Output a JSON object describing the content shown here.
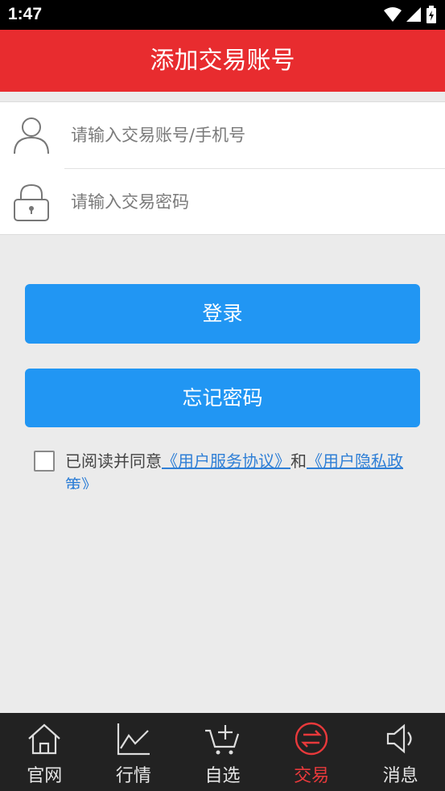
{
  "status_bar": {
    "time": "1:47"
  },
  "header": {
    "title": "添加交易账号"
  },
  "form": {
    "account_placeholder": "请输入交易账号/手机号",
    "password_placeholder": "请输入交易密码"
  },
  "buttons": {
    "login": "登录",
    "forgot_password": "忘记密码"
  },
  "agreement": {
    "prefix": "已阅读并同意",
    "link1": "《用户服务协议》",
    "middle": "和",
    "link2": "《用户隐私政策》"
  },
  "tab_bar": {
    "tabs": [
      {
        "label": "官网",
        "icon": "home-icon"
      },
      {
        "label": "行情",
        "icon": "chart-icon"
      },
      {
        "label": "自选",
        "icon": "cart-icon"
      },
      {
        "label": "交易",
        "icon": "swap-icon",
        "active": true
      },
      {
        "label": "消息",
        "icon": "speaker-icon"
      }
    ]
  },
  "colors": {
    "header_red": "#e82c2f",
    "button_blue": "#2196f3",
    "active_tab": "#e8393b",
    "link_blue": "#2f7fd6"
  }
}
